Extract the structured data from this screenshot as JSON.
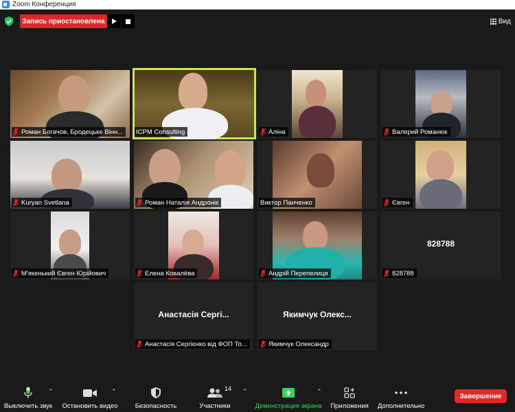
{
  "window": {
    "title": "Zoom Конференция"
  },
  "topbar": {
    "recording_label": "Запись приостановлена",
    "view_label": "Вид"
  },
  "colors": {
    "accent_active_speaker": "#c6e74f",
    "recording_red": "#e02828",
    "end_red": "#e02828",
    "share_green": "#35d45a",
    "muted_mic_red": "#e02828"
  },
  "participants": [
    {
      "name": "Роман Богачов, Бродецьке Вінн...",
      "muted": true,
      "video": true
    },
    {
      "name": "ICPM Consulting",
      "muted": false,
      "video": true,
      "active_speaker": true
    },
    {
      "name": "Аліна",
      "muted": true,
      "video": true
    },
    {
      "name": "Валерий Романюк",
      "muted": true,
      "video": true
    },
    {
      "name": "Kuryan Svetlana",
      "muted": true,
      "video": true
    },
    {
      "name": "Роман Наталія Андронік",
      "muted": true,
      "video": true
    },
    {
      "name": "Виктор Панченко",
      "muted": false,
      "video": true
    },
    {
      "name": "Євген",
      "muted": true,
      "video": true
    },
    {
      "name": "М'якенький Євген Юрійович",
      "muted": true,
      "video": true
    },
    {
      "name": "Елена Ковалёва",
      "muted": true,
      "video": true
    },
    {
      "name": "Андрій Перепелиця",
      "muted": true,
      "video": true
    },
    {
      "name": "828788",
      "big_name": "828788",
      "muted": true,
      "video": false
    },
    {
      "name": "Анастасія Сергієнко від ФОП То...",
      "big_name": "Анастасія  Сергі...",
      "muted": true,
      "video": false
    },
    {
      "name": "Якимчук Олександр",
      "big_name": "Якимчук  Олекс...",
      "muted": true,
      "video": false
    }
  ],
  "toolbar": {
    "mute_label": "Выключить звук",
    "video_label": "Остановить видео",
    "security_label": "Безопасность",
    "participants_label": "Участники",
    "participants_count": "14",
    "share_label": "Демонстрация экрана",
    "apps_label": "Приложения",
    "more_label": "Дополнительно",
    "end_label": "Завершение",
    "icons": [
      "microphone-icon",
      "video-camera-icon",
      "shield-icon",
      "participants-icon",
      "share-screen-icon",
      "apps-icon",
      "more-icon",
      "caret-up-icon"
    ]
  }
}
